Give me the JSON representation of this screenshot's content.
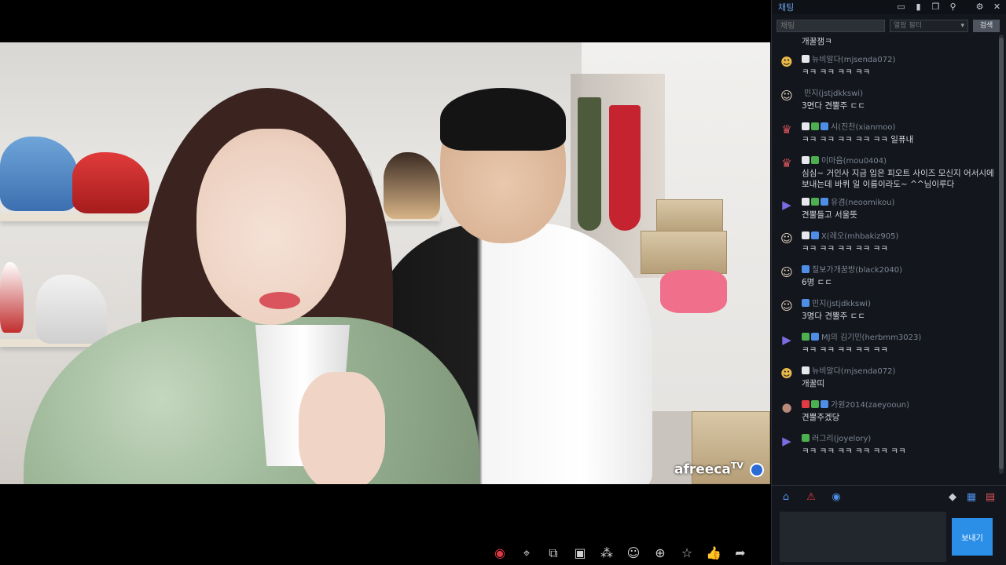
{
  "chat": {
    "title": "채팅",
    "search_placeholder": "채팅",
    "filter_placeholder": "열람 필터",
    "confirm_label": "검색",
    "send_label": "보내기",
    "header_fragment": "개꿀잼ㅋ",
    "messages": [
      {
        "avatar": "gold-avatar-icon",
        "badges": [
          "white"
        ],
        "nick": "뉴비알다(mjsenda072)",
        "text": "",
        "extra": "ㅋㅋ ㅋㅋ ㅋㅋ ㅋㅋ"
      },
      {
        "avatar": "face-avatar-icon",
        "badges": [],
        "nick": "민지(jstjdkkswi)",
        "text": "3면다 견뿔주 ㄷㄷ"
      },
      {
        "avatar": "red-avatar-icon",
        "badges": [
          "white",
          "green",
          "blue"
        ],
        "nick": "시(진찬(xianmoo)",
        "text": "ㅋㅋ ㅋㅋ ㅋㅋ ㅋㅋ ㅋㅋ 일퓨내"
      },
      {
        "avatar": "red-avatar-icon",
        "badges": [
          "white",
          "green"
        ],
        "nick": "이마음(mou0404)",
        "text": "심심~ 거인사 지금 입은 피오트 사이즈 모신지 어서시에 보내는데 바퀴 일 이름이라도~ ^^님이루다"
      },
      {
        "avatar": "chevron-avatar-icon",
        "badges": [
          "white",
          "green",
          "blue"
        ],
        "nick": "유겸(neoomikou)",
        "text": "견뿔들고 서울뜻"
      },
      {
        "avatar": "face-avatar-icon",
        "badges": [
          "white",
          "blue"
        ],
        "nick": "X(레오(mhbakiz905)",
        "text": "ㅋㅋ ㅋㅋ ㅋㅋ ㅋㅋ ㅋㅋ"
      },
      {
        "avatar": "face-avatar-icon",
        "badges": [
          "blue"
        ],
        "nick": "질보가개꿈방(black2040)",
        "text": "6명 ㄷㄷ"
      },
      {
        "avatar": "face-avatar-icon",
        "badges": [
          "blue"
        ],
        "nick": "민지(jstjdkkswi)",
        "text": "3명다 견뿔주 ㄷㄷ"
      },
      {
        "avatar": "chevron-avatar-icon",
        "badges": [
          "green",
          "blue"
        ],
        "nick": "MJ의 김기민(herbmm3023)",
        "text": "ㅋㅋ ㅋㅋ ㅋㅋ ㅋㅋ ㅋㅋ"
      },
      {
        "avatar": "gold-avatar-icon",
        "badges": [
          "white"
        ],
        "nick": "뉴비알다(mjsenda072)",
        "text": "개꿀띠"
      },
      {
        "avatar": "photo-avatar-icon",
        "badges": [
          "heart",
          "green",
          "blue"
        ],
        "nick": "가원2014(zaeyooun)",
        "text": "견뿔주겠당"
      },
      {
        "avatar": "chevron-avatar-icon",
        "badges": [
          "green"
        ],
        "nick": "러그리(joyelory)",
        "text": "ㅋㅋ ㅋㅋ ㅋㅋ ㅋㅋ ㅋㅋ ㅋㅋ"
      }
    ]
  },
  "video": {
    "watermark": "afreeca",
    "watermark_tv": "TV"
  },
  "controls": [
    "record-icon",
    "location-icon",
    "popout-icon",
    "capture-icon",
    "share-people-icon",
    "emoji-icon",
    "search-icon",
    "star-icon",
    "thumbs-up-icon",
    "share-icon"
  ],
  "colors": {
    "accent": "#2b8fe8",
    "panel_bg": "#13161c",
    "record_red": "#e23a45"
  }
}
